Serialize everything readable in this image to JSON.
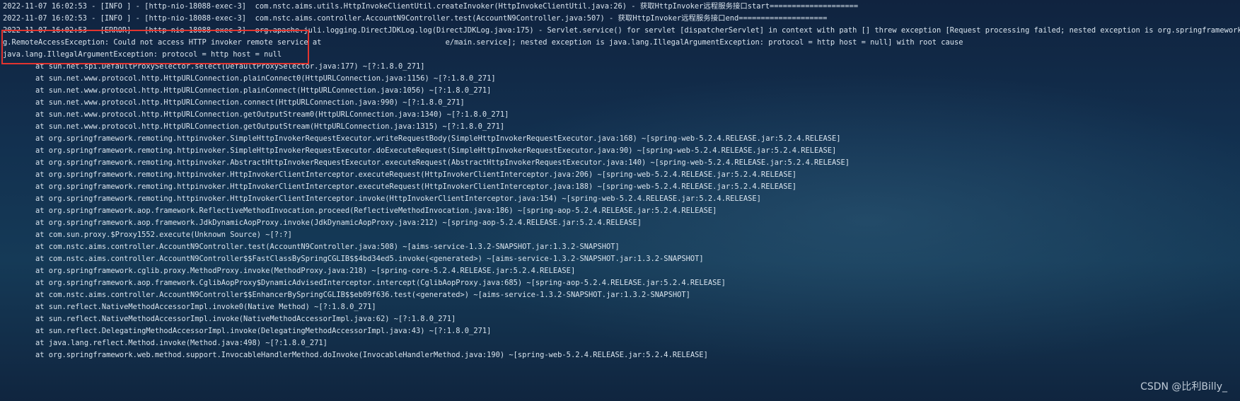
{
  "console": {
    "lines": [
      "2022-11-07 16:02:53 - [INFO ] - [http-nio-18088-exec-3]  com.nstc.aims.utils.HttpInvokeClientUtil.createInvoker(HttpInvokeClientUtil.java:26) - 获取HttpInvoker远程服务接口start====================",
      "2022-11-07 16:02:53 - [INFO ] - [http-nio-18088-exec-3]  com.nstc.aims.controller.AccountN9Controller.test(AccountN9Controller.java:507) - 获取HttpInvoker远程服务接口end====================",
      "2022-11-07 16:02:53 - [ERROR] - [http-nio-18088-exec-3]  org.apache.juli.logging.DirectJDKLog.log(DirectJDKLog.java:175) - Servlet.service() for servlet [dispatcherServlet] in context with path [] threw exception [Request processing failed; nested exception is org.springframework.remotin",
      "g.RemoteAccessException: Could not access HTTP invoker remote service at                            e/main.service]; nested exception is java.lang.IllegalArgumentException: protocol = http host = null] with root cause",
      "java.lang.IllegalArgumentException: protocol = http host = null"
    ],
    "stack": [
      "at sun.net.spi.DefaultProxySelector.select(DefaultProxySelector.java:177) ~[?:1.8.0_271]",
      "at sun.net.www.protocol.http.HttpURLConnection.plainConnect0(HttpURLConnection.java:1156) ~[?:1.8.0_271]",
      "at sun.net.www.protocol.http.HttpURLConnection.plainConnect(HttpURLConnection.java:1056) ~[?:1.8.0_271]",
      "at sun.net.www.protocol.http.HttpURLConnection.connect(HttpURLConnection.java:990) ~[?:1.8.0_271]",
      "at sun.net.www.protocol.http.HttpURLConnection.getOutputStream0(HttpURLConnection.java:1340) ~[?:1.8.0_271]",
      "at sun.net.www.protocol.http.HttpURLConnection.getOutputStream(HttpURLConnection.java:1315) ~[?:1.8.0_271]",
      "at org.springframework.remoting.httpinvoker.SimpleHttpInvokerRequestExecutor.writeRequestBody(SimpleHttpInvokerRequestExecutor.java:168) ~[spring-web-5.2.4.RELEASE.jar:5.2.4.RELEASE]",
      "at org.springframework.remoting.httpinvoker.SimpleHttpInvokerRequestExecutor.doExecuteRequest(SimpleHttpInvokerRequestExecutor.java:90) ~[spring-web-5.2.4.RELEASE.jar:5.2.4.RELEASE]",
      "at org.springframework.remoting.httpinvoker.AbstractHttpInvokerRequestExecutor.executeRequest(AbstractHttpInvokerRequestExecutor.java:140) ~[spring-web-5.2.4.RELEASE.jar:5.2.4.RELEASE]",
      "at org.springframework.remoting.httpinvoker.HttpInvokerClientInterceptor.executeRequest(HttpInvokerClientInterceptor.java:206) ~[spring-web-5.2.4.RELEASE.jar:5.2.4.RELEASE]",
      "at org.springframework.remoting.httpinvoker.HttpInvokerClientInterceptor.executeRequest(HttpInvokerClientInterceptor.java:188) ~[spring-web-5.2.4.RELEASE.jar:5.2.4.RELEASE]",
      "at org.springframework.remoting.httpinvoker.HttpInvokerClientInterceptor.invoke(HttpInvokerClientInterceptor.java:154) ~[spring-web-5.2.4.RELEASE.jar:5.2.4.RELEASE]",
      "at org.springframework.aop.framework.ReflectiveMethodInvocation.proceed(ReflectiveMethodInvocation.java:186) ~[spring-aop-5.2.4.RELEASE.jar:5.2.4.RELEASE]",
      "at org.springframework.aop.framework.JdkDynamicAopProxy.invoke(JdkDynamicAopProxy.java:212) ~[spring-aop-5.2.4.RELEASE.jar:5.2.4.RELEASE]",
      "at com.sun.proxy.$Proxy1552.execute(Unknown Source) ~[?:?]",
      "at com.nstc.aims.controller.AccountN9Controller.test(AccountN9Controller.java:508) ~[aims-service-1.3.2-SNAPSHOT.jar:1.3.2-SNAPSHOT]",
      "at com.nstc.aims.controller.AccountN9Controller$$FastClassBySpringCGLIB$$4bd34ed5.invoke(<generated>) ~[aims-service-1.3.2-SNAPSHOT.jar:1.3.2-SNAPSHOT]",
      "at org.springframework.cglib.proxy.MethodProxy.invoke(MethodProxy.java:218) ~[spring-core-5.2.4.RELEASE.jar:5.2.4.RELEASE]",
      "at org.springframework.aop.framework.CglibAopProxy$DynamicAdvisedInterceptor.intercept(CglibAopProxy.java:685) ~[spring-aop-5.2.4.RELEASE.jar:5.2.4.RELEASE]",
      "at com.nstc.aims.controller.AccountN9Controller$$EnhancerBySpringCGLIB$$eb09f636.test(<generated>) ~[aims-service-1.3.2-SNAPSHOT.jar:1.3.2-SNAPSHOT]",
      "at sun.reflect.NativeMethodAccessorImpl.invoke0(Native Method) ~[?:1.8.0_271]",
      "at sun.reflect.NativeMethodAccessorImpl.invoke(NativeMethodAccessorImpl.java:62) ~[?:1.8.0_271]",
      "at sun.reflect.DelegatingMethodAccessorImpl.invoke(DelegatingMethodAccessorImpl.java:43) ~[?:1.8.0_271]",
      "at java.lang.reflect.Method.invoke(Method.java:498) ~[?:1.8.0_271]",
      "at org.springframework.web.method.support.InvocableHandlerMethod.doInvoke(InvocableHandlerMethod.java:190) ~[spring-web-5.2.4.RELEASE.jar:5.2.4.RELEASE]"
    ]
  },
  "watermark": "CSDN @比利Billy_",
  "colors": {
    "background": "#12304f",
    "text": "#d9e4ee",
    "highlight_border": "#e3342f"
  }
}
